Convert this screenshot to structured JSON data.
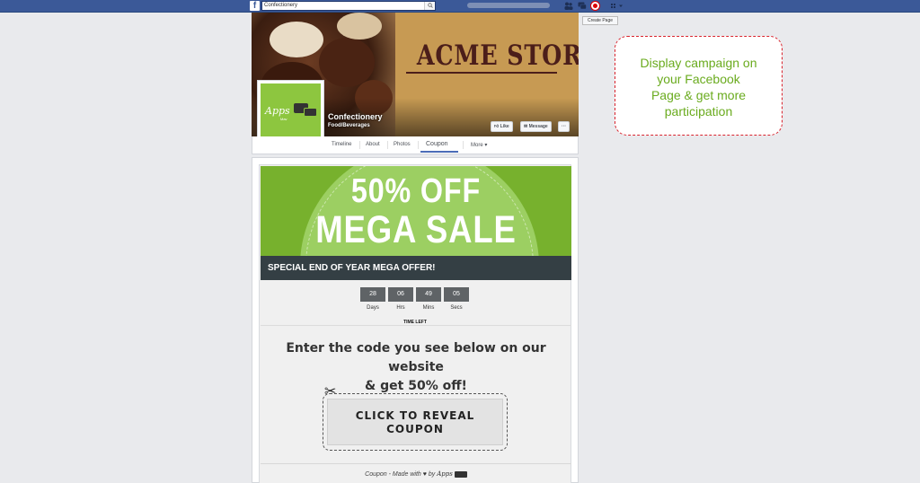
{
  "topbar": {
    "search_value": "Confectionery",
    "create_page_label": "Create Page",
    "brand_color": "#3b5998"
  },
  "cover": {
    "store_title": "ACME STORE",
    "page_name": "Confectionery",
    "page_category": "Food/Beverages",
    "like_label": "Like",
    "message_label": "Message",
    "more_label": "···"
  },
  "avatar": {
    "logo_text": "Apps",
    "logo_sub": "Mav"
  },
  "tabs": [
    {
      "label": "Timeline"
    },
    {
      "label": "About"
    },
    {
      "label": "Photos"
    },
    {
      "label": "Coupon",
      "active": true
    },
    {
      "label": "More ▾"
    }
  ],
  "campaign": {
    "banner_line1": "50% OFF",
    "banner_line2": "MEGA SALE",
    "offer_text": "SPECIAL END OF YEAR MEGA OFFER!",
    "timer": [
      {
        "value": "28",
        "unit": "Days"
      },
      {
        "value": "06",
        "unit": "Hrs"
      },
      {
        "value": "49",
        "unit": "Mins"
      },
      {
        "value": "05",
        "unit": "Secs"
      }
    ],
    "time_left_label": "TIME LEFT",
    "instruction_line1": "Enter the code you see below on our website",
    "instruction_line2": "& get 50% off!",
    "reveal_line1": "CLICK TO REVEAL",
    "reveal_line2": "COUPON",
    "footer_prefix": "Coupon - Made with",
    "footer_by": "by",
    "footer_logo": "Apps",
    "accent_green": "#77b12d",
    "dark_bar": "#343f44"
  },
  "callout": {
    "line1": "Display campaign on",
    "line2": "your Facebook",
    "line3": "Page & get more",
    "line4": "participation",
    "text_color": "#6aab1e",
    "border_color": "#d9232d"
  }
}
